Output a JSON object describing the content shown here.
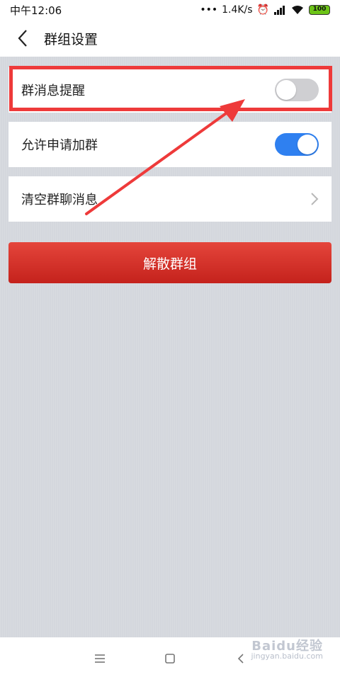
{
  "status_bar": {
    "time": "中午12:06",
    "speed": "1.4K/s",
    "battery": "100"
  },
  "nav": {
    "title": "群组设置"
  },
  "settings": {
    "group_reminder": {
      "label": "群消息提醒",
      "enabled": false
    },
    "allow_join": {
      "label": "允许申请加群",
      "enabled": true
    },
    "clear_chat": {
      "label": "清空群聊消息"
    }
  },
  "actions": {
    "dissolve_label": "解散群组"
  },
  "watermark": {
    "brand": "Baidu经验",
    "url": "jingyan.baidu.com"
  },
  "colors": {
    "toggle_on": "#2f80f0",
    "danger": "#d4302a",
    "highlight": "#ee3a3a"
  }
}
